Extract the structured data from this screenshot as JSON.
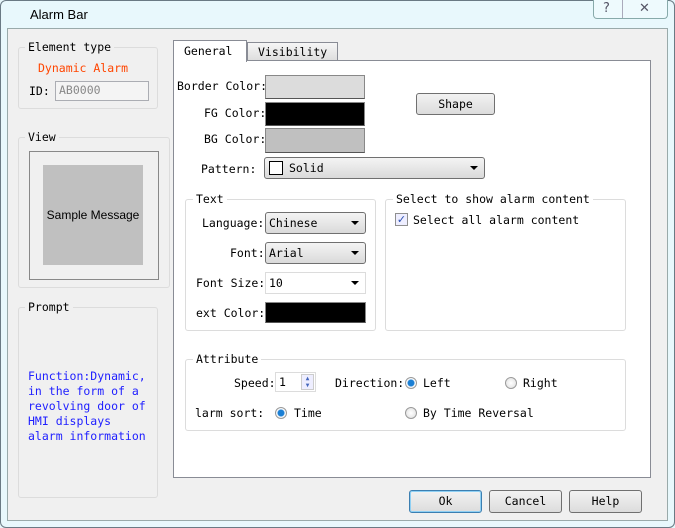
{
  "window": {
    "title": "Alarm Bar",
    "help_icon": "?",
    "close_icon": "✕"
  },
  "element_type": {
    "legend": "Element type",
    "value": "Dynamic Alarm",
    "value_color": "#ff4500",
    "id_label": "ID:",
    "id_value": "AB0000"
  },
  "view": {
    "legend": "View",
    "sample": "Sample Message"
  },
  "prompt": {
    "legend": "Prompt",
    "text": "Function:Dynamic, in the form of a revolving door of HMI displays alarm information",
    "text_color": "#2020ff"
  },
  "tabs": [
    {
      "label": "General",
      "active": true
    },
    {
      "label": "Visibility",
      "active": false
    }
  ],
  "general": {
    "border_color_label": "Border Color:",
    "border_color": "#dcdcdc",
    "fg_color_label": "FG Color:",
    "fg_color": "#000000",
    "bg_color_label": "BG Color:",
    "bg_color": "#c0c0c0",
    "shape_button": "Shape",
    "pattern_label": "Pattern:",
    "pattern_value": "Solid"
  },
  "text_group": {
    "legend": "Text",
    "language_label": "Language:",
    "language_value": "Chinese",
    "font_label": "Font:",
    "font_value": "Arial",
    "font_size_label": "Font Size:",
    "font_size_value": "10",
    "text_color_label": "ext Color:",
    "text_color": "#000000"
  },
  "alarm_content": {
    "legend": "Select to show alarm content",
    "select_all_label": "Select all alarm content",
    "select_all_checked": true
  },
  "attribute": {
    "legend": "Attribute",
    "speed_label": "Speed:",
    "speed_value": "1",
    "direction_label": "Direction:",
    "direction_options": [
      "Left",
      "Right"
    ],
    "direction_selected": "Left",
    "sort_label": "larm sort:",
    "sort_options": [
      "Time",
      "By Time Reversal"
    ],
    "sort_selected": "Time"
  },
  "footer": {
    "ok": "Ok",
    "cancel": "Cancel",
    "help": "Help"
  }
}
